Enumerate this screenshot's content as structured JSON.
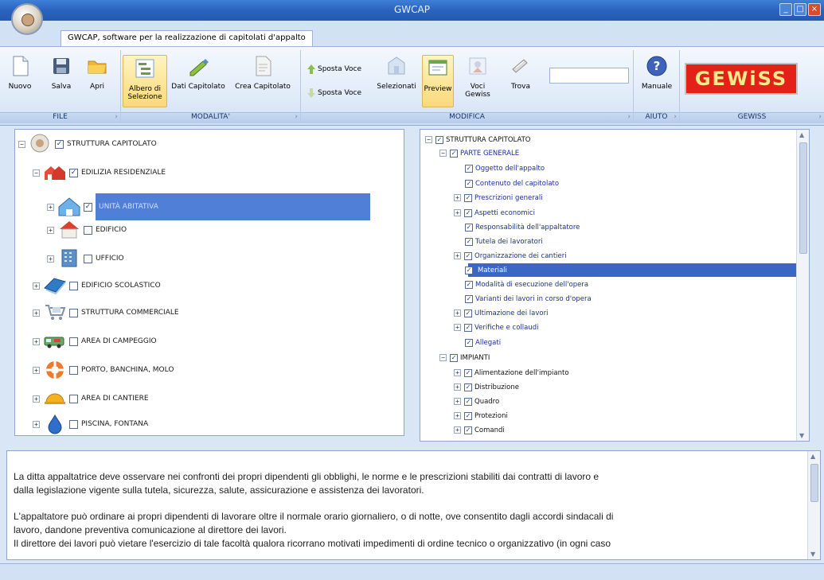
{
  "window": {
    "title": "GWCAP"
  },
  "tab": {
    "label": "GWCAP, software per la realizzazione di capitolati d'appalto"
  },
  "ribbon": {
    "file": {
      "label": "FILE",
      "nuovo": "Nuovo",
      "salva": "Salva",
      "apri": "Apri"
    },
    "modalita": {
      "label": "MODALITA'",
      "albero": "Albero di Selezione",
      "dati": "Dati Capitolato",
      "crea": "Crea Capitolato"
    },
    "modifica": {
      "label": "MODIFICA",
      "sposta1": "Sposta Voce",
      "sposta2": "Sposta Voce",
      "selezionati": "Selezionati",
      "preview": "Preview",
      "voci": "Voci Gewiss",
      "trova": "Trova",
      "trova_value": ""
    },
    "aiuto": {
      "label": "AIUTO",
      "manuale": "Manuale"
    },
    "gewiss": {
      "label": "GEWISS",
      "logo": "GEWiSS"
    }
  },
  "left_tree": {
    "root": "STRUTTURA CAPITOLATO",
    "edilizia": "EDILIZIA RESIDENZIALE",
    "unita": "UNITÀ ABITATIVA",
    "edificio": "EDIFICIO",
    "ufficio": "UFFICIO",
    "scolastico": "EDIFICIO SCOLASTICO",
    "commerciale": "STRUTTURA COMMERCIALE",
    "campeggio": "AREA DI CAMPEGGIO",
    "porto": "PORTO, BANCHINA, MOLO",
    "cantiere": "AREA DI CANTIERE",
    "piscina": "PISCINA, FONTANA"
  },
  "right_tree": {
    "root": "STRUTTURA CAPITOLATO",
    "parte_generale": "PARTE GENERALE",
    "items": [
      "Oggetto dell'appalto",
      "Contenuto del capitolato",
      "Prescrizioni generali",
      "Aspetti economici",
      "Responsabilità dell'appaltatore",
      "Tutela dei lavoratori",
      "Organizzazione dei cantieri",
      "Materiali",
      "Modalità di esecuzione dell'opera",
      "Varianti dei lavori in corso d'opera",
      "Ultimazione dei lavori",
      "Verifiche e collaudi",
      "Allegati"
    ],
    "impianti": "IMPIANTI",
    "impianti_items": [
      "Alimentazione dell'impianto",
      "Distribuzione",
      "Quadro",
      "Protezioni",
      "Comandi"
    ]
  },
  "description": {
    "p1_line1": "La ditta appaltatrice deve osservare nei confronti dei propri dipendenti gli obblighi, le norme e le prescrizioni stabiliti dai contratti di lavoro e",
    "p1_line2": "dalla legislazione vigente sulla tutela, sicurezza, salute, assicurazione e assistenza dei lavoratori.",
    "p2_line1": "L'appaltatore può ordinare ai propri dipendenti di lavorare oltre il normale orario giornaliero, o di notte, ove consentito dagli accordi sindacali di",
    "p2_line2": "lavoro, dandone preventiva comunicazione al direttore dei lavori.",
    "p2_line3": "Il direttore dei lavori può vietare l'esercizio di tale facoltà qualora ricorrano motivati impedimenti di ordine tecnico o organizzativo (in ogni caso"
  }
}
